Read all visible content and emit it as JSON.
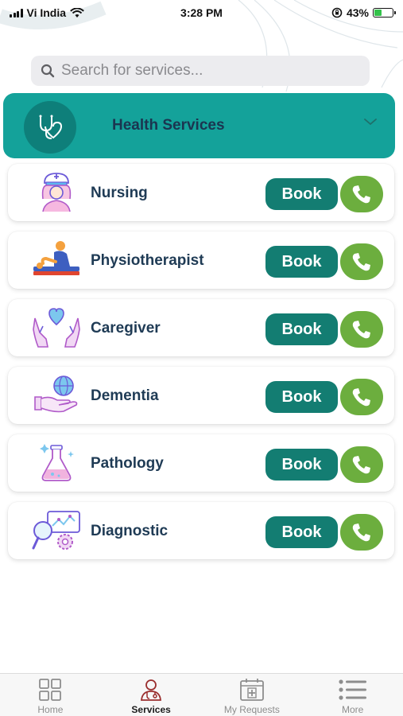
{
  "status_bar": {
    "carrier": "Vi India",
    "time": "3:28 PM",
    "battery_percent": "43%",
    "battery_level": 0.43
  },
  "search": {
    "placeholder": "Search for services..."
  },
  "category": {
    "title": "Health Services",
    "expanded": true,
    "color": "#14a29a"
  },
  "services": [
    {
      "name": "Nursing",
      "icon": "nurse-icon",
      "book_label": "Book"
    },
    {
      "name": "Physiotherapist",
      "icon": "physiotherapy-icon",
      "book_label": "Book"
    },
    {
      "name": "Caregiver",
      "icon": "caregiver-hands-icon",
      "book_label": "Book"
    },
    {
      "name": "Dementia",
      "icon": "globe-hand-icon",
      "book_label": "Book"
    },
    {
      "name": "Pathology",
      "icon": "lab-flask-icon",
      "book_label": "Book"
    },
    {
      "name": "Diagnostic",
      "icon": "diagnostic-monitor-icon",
      "book_label": "Book"
    }
  ],
  "colors": {
    "book_button": "#137d72",
    "call_button": "#6cae3e",
    "active_tab_icon": "#9b2f2f"
  },
  "tabs": [
    {
      "label": "Home",
      "icon": "grid-icon",
      "active": false
    },
    {
      "label": "Services",
      "icon": "doctor-icon",
      "active": true
    },
    {
      "label": "My Requests",
      "icon": "calendar-plus-icon",
      "active": false
    },
    {
      "label": "More",
      "icon": "menu-list-icon",
      "active": false
    }
  ]
}
